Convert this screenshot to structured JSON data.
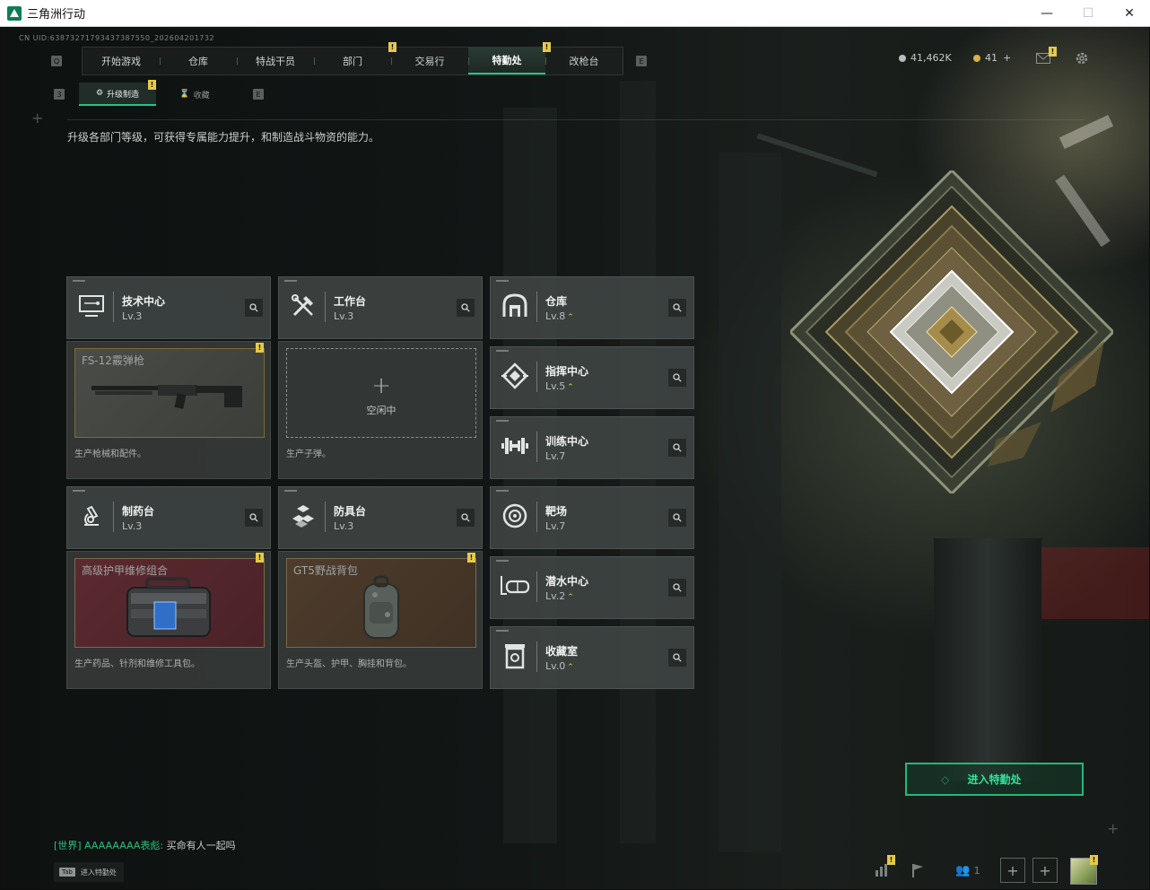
{
  "window": {
    "title": "三角洲行动",
    "controls": {
      "minimize": "—",
      "maximize": "☐",
      "close": "✕"
    }
  },
  "uid_text": "CN UID:63873271793437387550_202604201732",
  "top_nav": {
    "left_key": "Q",
    "right_key": "E",
    "tabs": [
      {
        "label": "开始游戏",
        "badge": ""
      },
      {
        "label": "仓库",
        "badge": ""
      },
      {
        "label": "特战干员",
        "badge": ""
      },
      {
        "label": "部门",
        "badge": "!"
      },
      {
        "label": "交易行",
        "badge": ""
      },
      {
        "label": "特勤处",
        "badge": "!",
        "active": true
      },
      {
        "label": "改枪台",
        "badge": ""
      }
    ]
  },
  "currency": {
    "silver": "41,462K",
    "gold": "41",
    "gold_add": "+"
  },
  "header_icons": {
    "mail": "mail-icon",
    "settings": "gear-icon",
    "mail_badge": "!"
  },
  "sub_nav": {
    "left_key": "3",
    "right_key": "E",
    "tabs": [
      {
        "label": "升级制造",
        "badge": "!",
        "active": true
      },
      {
        "label": "收藏",
        "badge": ""
      }
    ]
  },
  "description": "升级各部门等级，可获得专属能力提升，和制造战斗物资的能力。",
  "departments": [
    {
      "name": "技术中心",
      "level": "Lv.3",
      "upgradable": false,
      "icon": "monitor-icon"
    },
    {
      "name": "工作台",
      "level": "Lv.3",
      "upgradable": false,
      "icon": "tools-icon"
    },
    {
      "name": "仓库",
      "level": "Lv.8",
      "upgradable": true,
      "icon": "warehouse-icon"
    },
    {
      "name": "指挥中心",
      "level": "Lv.5",
      "upgradable": true,
      "icon": "command-icon"
    },
    {
      "name": "训练中心",
      "level": "Lv.7",
      "upgradable": false,
      "icon": "dumbbell-icon"
    },
    {
      "name": "制药台",
      "level": "Lv.3",
      "upgradable": false,
      "icon": "microscope-icon"
    },
    {
      "name": "防具台",
      "level": "Lv.3",
      "upgradable": false,
      "icon": "armor-blocks-icon"
    },
    {
      "name": "靶场",
      "level": "Lv.7",
      "upgradable": false,
      "icon": "target-icon"
    },
    {
      "name": "潜水中心",
      "level": "Lv.2",
      "upgradable": true,
      "icon": "diving-mask-icon"
    },
    {
      "name": "收藏室",
      "level": "Lv.0",
      "upgradable": true,
      "icon": "collection-icon"
    }
  ],
  "productions": [
    {
      "item": "FS-12霰弹枪",
      "note": "生产枪械和配件。",
      "badge": "!"
    },
    {
      "item": "",
      "empty_label": "空闲中",
      "note": "生产子弹。",
      "badge": ""
    },
    {
      "item": "高级护甲维修组合",
      "note": "生产药品、针剂和维修工具包。",
      "badge": "!"
    },
    {
      "item": "GT5野战背包",
      "note": "生产头盔、护甲、胸挂和背包。",
      "badge": "!"
    }
  ],
  "enter_button": "进入特勤处",
  "chat": {
    "channel": "[世界]",
    "speaker": "AAAAAAAA表彪:",
    "message": "买命有人一起吗"
  },
  "tab_hint": {
    "key": "Tab",
    "label": "进入特勤处"
  },
  "bottom_bar": {
    "stats_badge": "!",
    "friends_count": "1",
    "avatar_badge": "!"
  },
  "colors": {
    "accent_green": "#26c484",
    "badge_yellow": "#e6c94a",
    "chat_green": "#2bbf7e"
  }
}
